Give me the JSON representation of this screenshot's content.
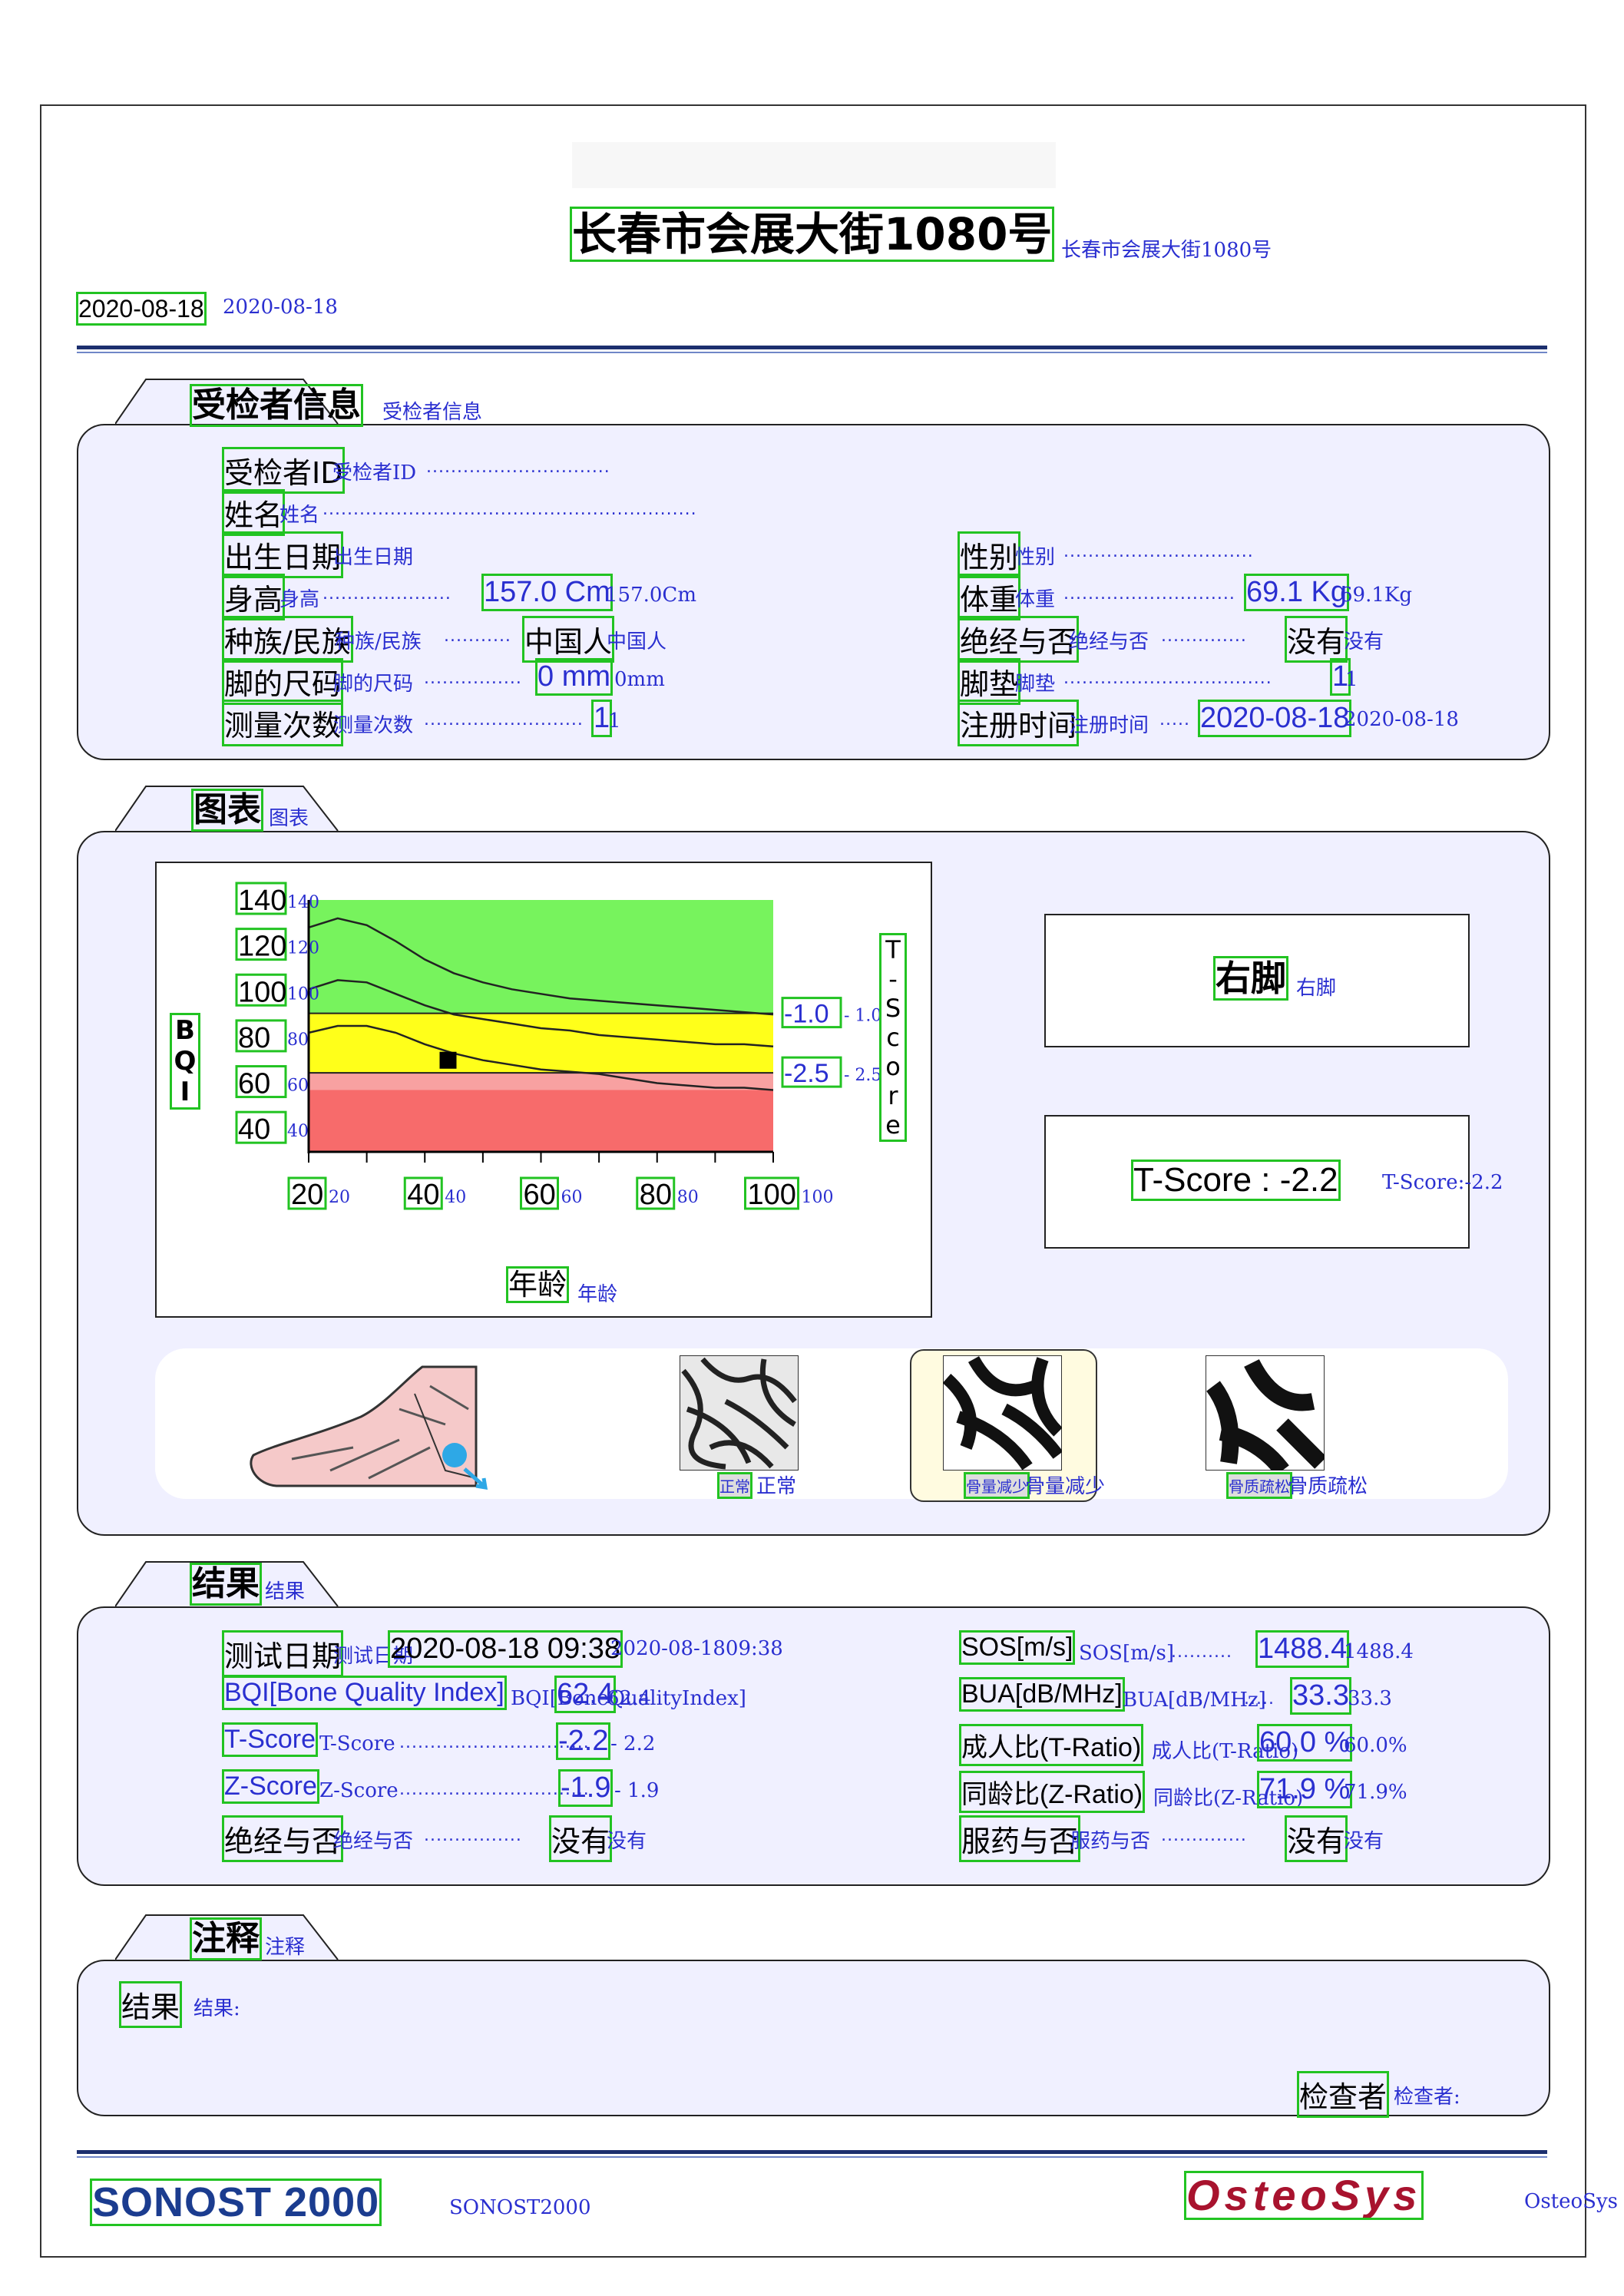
{
  "header": {
    "address": "长春市会展大街1080号",
    "address_note": "长春市会展大街1080号",
    "date": "2020-08-18",
    "date_note": "2020-08-18"
  },
  "patient": {
    "section_title": "受检者信息",
    "section_note": "受检者信息",
    "id_label": "受检者ID",
    "id_note": "受检者ID",
    "name_label": "姓名",
    "name_note": "姓名",
    "dob_label": "出生日期",
    "dob_note": "出生日期",
    "height_label": "身高",
    "height_note": "身高",
    "height_value": "157.0 Cm",
    "height_value_note": "157.0Cm",
    "ethnicity_label": "种族/民族",
    "ethnicity_note": "种族/民族",
    "ethnicity_value": "中国人",
    "ethnicity_value_note": "中国人",
    "shoe_label": "脚的尺码",
    "shoe_note": "脚的尺码",
    "shoe_value": "0 mm",
    "shoe_value_note": "0mm",
    "count_label": "测量次数",
    "count_note": "测量次数",
    "count_value": "1",
    "count_value_note": "1",
    "sex_label": "性别",
    "sex_note": "性别",
    "weight_label": "体重",
    "weight_note": "体重",
    "weight_value": "69.1 Kg",
    "weight_value_note": "69.1Kg",
    "menopause_label": "绝经与否",
    "menopause_note": "绝经与否",
    "menopause_value": "没有",
    "menopause_value_note": "没有",
    "pad_label": "脚垫",
    "pad_note": "脚垫",
    "pad_value": "1",
    "pad_value_note": "1",
    "reg_label": "注册时间",
    "reg_note": "注册时间",
    "reg_value": "2020-08-18",
    "reg_value_note": "2020-08-18"
  },
  "chart_section": {
    "title": "图表",
    "title_note": "图表",
    "side_label": "T-Score",
    "bqi_label": "BQI",
    "xlabel": "年龄",
    "xlabel_note": "年龄",
    "foot": "右脚",
    "foot_note": "右脚",
    "tscore_text": "T-Score : -2.2",
    "tscore_note": "T-Score:-2.2",
    "img_labels": [
      "正常",
      "骨量减少",
      "骨质疏松"
    ],
    "img_notes": [
      "正常",
      "骨量减少",
      "骨质疏松"
    ]
  },
  "chart_data": {
    "type": "line",
    "xlabel": "年龄",
    "ylabel": "BQI",
    "xlim": [
      20,
      100
    ],
    "ylim": [
      30,
      140
    ],
    "x_ticks": [
      "20",
      "40",
      "60",
      "80",
      "100"
    ],
    "x_tick_notes": [
      "20",
      "40",
      "60",
      "80",
      "100"
    ],
    "y_ticks": [
      "140",
      "120",
      "100",
      "80",
      "60",
      "40"
    ],
    "y_tick_notes": [
      "140",
      "120",
      "100",
      "80",
      "60",
      "40"
    ],
    "right_ticks": [
      "-1.0",
      "-2.5"
    ],
    "right_tick_notes": [
      "-1.0",
      "-2.5"
    ],
    "zones": [
      {
        "from": 90.5,
        "to": 140,
        "color": "#77f35d"
      },
      {
        "from": 64.5,
        "to": 90.5,
        "color": "#ffff1a"
      },
      {
        "from": 57,
        "to": 64.5,
        "color": "#f8a1a1"
      },
      {
        "from": 30,
        "to": 57,
        "color": "#f76b6b"
      }
    ],
    "series": [
      {
        "x": [
          20,
          25,
          30,
          35,
          40,
          45,
          50,
          55,
          60,
          65,
          70,
          75,
          80,
          85,
          90,
          95,
          100
        ],
        "values": [
          128,
          132,
          129,
          122,
          114,
          108,
          104,
          101,
          99,
          97,
          96,
          95,
          94,
          93,
          92,
          91,
          90
        ]
      },
      {
        "x": [
          20,
          25,
          30,
          35,
          40,
          45,
          50,
          55,
          60,
          65,
          70,
          75,
          80,
          85,
          90,
          95,
          100
        ],
        "values": [
          101,
          105,
          104,
          99,
          94,
          90,
          88,
          86,
          84,
          83,
          81,
          80,
          79,
          78,
          77,
          77,
          76
        ]
      },
      {
        "x": [
          20,
          25,
          30,
          35,
          40,
          45,
          50,
          55,
          60,
          65,
          70,
          75,
          80,
          85,
          90,
          95,
          100
        ],
        "values": [
          82,
          85,
          85,
          82,
          77,
          73,
          70,
          68,
          66,
          65,
          64,
          62,
          60,
          59,
          58,
          58,
          57
        ]
      }
    ],
    "point": {
      "x": 44,
      "y": 70
    }
  },
  "results": {
    "title": "结果",
    "title_note": "结果",
    "date_label": "测试日期",
    "date_note": "测试日期",
    "date_value": "2020-08-18 09:38",
    "date_value_note": "2020-08-1809:38",
    "bqi_label": "BQI[Bone Quality Index]",
    "bqi_note": "BQI[BoneQualityIndex]",
    "bqi_value": "62.4",
    "bqi_value_note": "62.4",
    "tscore_label": "T-Score",
    "tscore_note": "T-Score",
    "tscore_value": "-2.2",
    "tscore_value_note": "- 2.2",
    "zscore_label": "Z-Score",
    "zscore_note": "Z-Score",
    "zscore_value": "-1.9",
    "zscore_value_note": "- 1.9",
    "meno_label": "绝经与否",
    "meno_note": "绝经与否",
    "meno_value": "没有",
    "meno_value_note": "没有",
    "sos_label": "SOS[m/s]",
    "sos_note": "SOS[m/s]",
    "sos_value": "1488.4",
    "sos_value_note": "1488.4",
    "bua_label": "BUA[dB/MHz]",
    "bua_note": "BUA[dB/MHz]",
    "bua_value": "33.3",
    "bua_value_note": "33.3",
    "tratio_label": "成人比(T-Ratio)",
    "tratio_note": "成人比(T-Ratio)",
    "tratio_value": "60.0 %",
    "tratio_value_note": "60.0%",
    "zratio_label": "同龄比(Z-Ratio)",
    "zratio_note": "同龄比(Z-Ratio)",
    "zratio_value": "71.9 %",
    "zratio_value_note": "71.9%",
    "med_label": "服药与否",
    "med_note": "服药与否",
    "med_value": "没有",
    "med_value_note": "没有"
  },
  "notes": {
    "title": "注释",
    "title_note": "注释",
    "result_label": "结果",
    "result_note": "结果:",
    "examiner_label": "检查者",
    "examiner_note": "检查者:"
  },
  "footer": {
    "product": "SONOST 2000",
    "product_note": "SONOST2000",
    "brand": "OsteoSys",
    "brand_note": "OsteoSys"
  }
}
